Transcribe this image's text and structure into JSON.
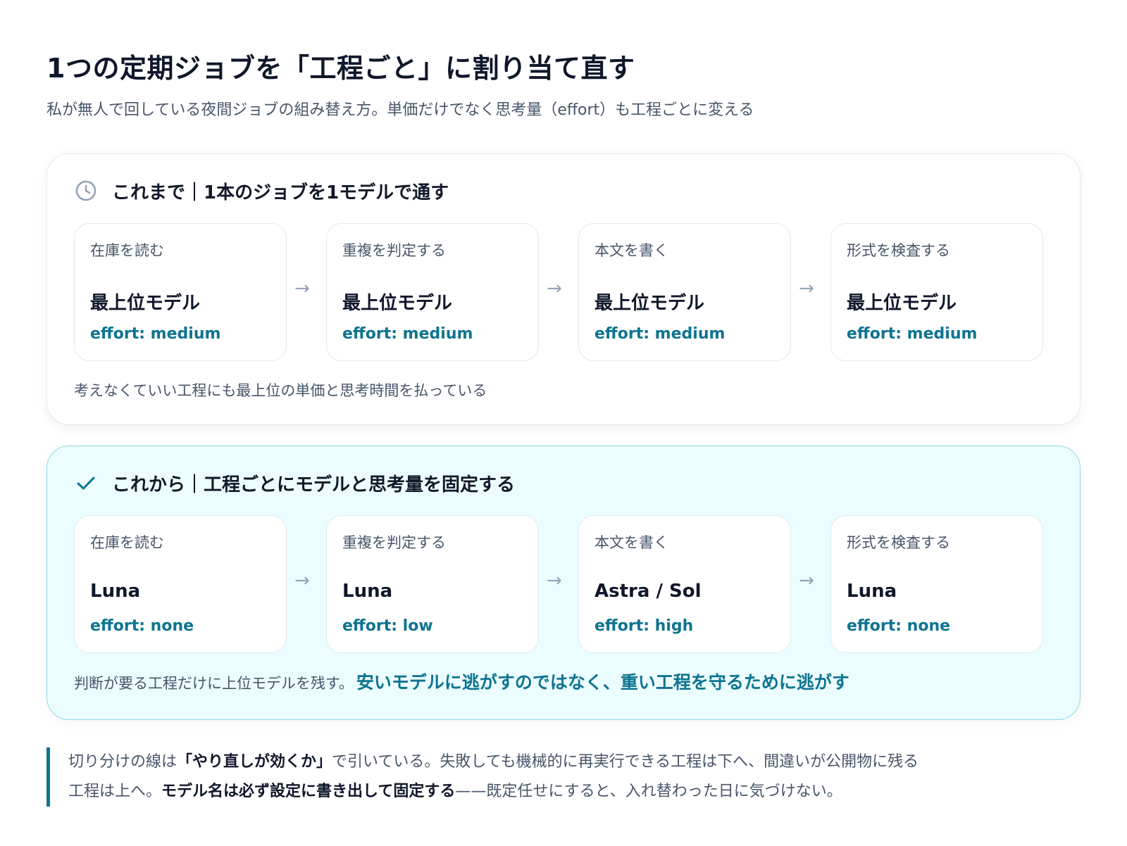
{
  "title": "1つの定期ジョブを「工程ごと」に割り当て直す",
  "subtitle": "私が無人で回している夜間ジョブの組み替え方。単価だけでなく思考量（effort）も工程ごとに変える",
  "before": {
    "icon": "clock-icon",
    "heading": "これまで｜1本のジョブを1モデルで通す",
    "steps": [
      {
        "name": "在庫を読む",
        "model": "最上位モデル",
        "effort": "effort: medium"
      },
      {
        "name": "重複を判定する",
        "model": "最上位モデル",
        "effort": "effort: medium"
      },
      {
        "name": "本文を書く",
        "model": "最上位モデル",
        "effort": "effort: medium"
      },
      {
        "name": "形式を検査する",
        "model": "最上位モデル",
        "effort": "effort: medium"
      }
    ],
    "arrow": "→",
    "note": "考えなくていい工程にも最上位の単価と思考時間を払っている"
  },
  "after": {
    "icon": "checkmark-icon",
    "heading": "これから｜工程ごとにモデルと思考量を固定する",
    "steps": [
      {
        "name": "在庫を読む",
        "model": "Luna",
        "effort": "effort: none"
      },
      {
        "name": "重複を判定する",
        "model": "Luna",
        "effort": "effort: low"
      },
      {
        "name": "本文を書く",
        "model": "Astra / Sol",
        "effort": "effort: high"
      },
      {
        "name": "形式を検査する",
        "model": "Luna",
        "effort": "effort: none"
      }
    ],
    "arrow": "→",
    "note": "判断が要る工程だけに上位モデルを残す。",
    "note_emphasis": "安いモデルに逃がすのではなく、重い工程を守るために逃がす"
  },
  "quote": {
    "line1_a": "切り分けの線は",
    "line1_b": "「やり直しが効くか」",
    "line1_c": "で引いている。失敗しても機械的に再実行できる工程は下へ、間違いが公開物に残る",
    "line2_a": "工程は上へ。",
    "line2_b": "モデル名は必ず設定に書き出して固定する",
    "line2_c": "——既定任せにすると、入れ替わった日に気づけない。"
  },
  "colors": {
    "accent": "#0e7490",
    "after_bg": "#ecfdff",
    "after_border": "#8fd9e6",
    "muted": "#475569"
  }
}
